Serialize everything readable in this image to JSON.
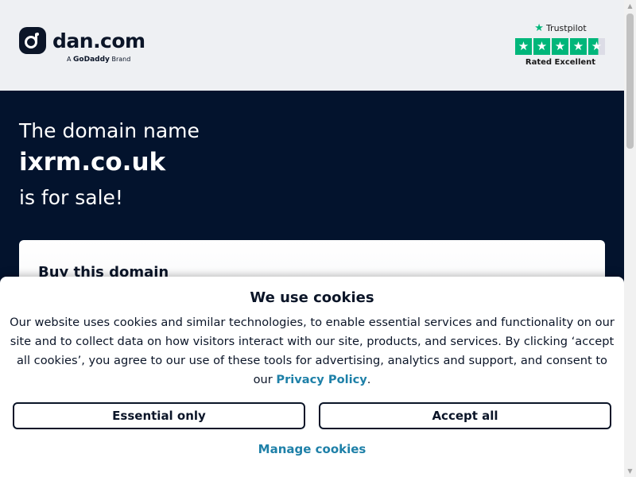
{
  "header": {
    "logo_text": "dan.com",
    "brand_prefix": "A",
    "brand_name": "GoDaddy",
    "brand_suffix": "Brand"
  },
  "trustpilot": {
    "label": "Trustpilot",
    "rating_text": "Rated Excellent",
    "stars": 4.5
  },
  "hero": {
    "line1": "The domain name",
    "domain": "ixrm.co.uk",
    "line3": "is for sale!"
  },
  "buy_card": {
    "title": "Buy this domain"
  },
  "cookie": {
    "title": "We use cookies",
    "text": "Our website uses cookies and similar technologies, to enable essential services and functionality on our site and to collect data on how visitors interact with our site, products, and services. By clicking ‘accept all cookies’, you agree to our use of these tools for advertising, analytics and support, and consent to our",
    "privacy_link": "Privacy Policy",
    "text_end": ".",
    "essential_button": "Essential only",
    "accept_button": "Accept all",
    "manage_link": "Manage cookies"
  },
  "colors": {
    "hero_bg": "#03132d",
    "header_bg": "#eef0f3",
    "trustpilot_green": "#00b67a",
    "link": "#1e80a8"
  }
}
